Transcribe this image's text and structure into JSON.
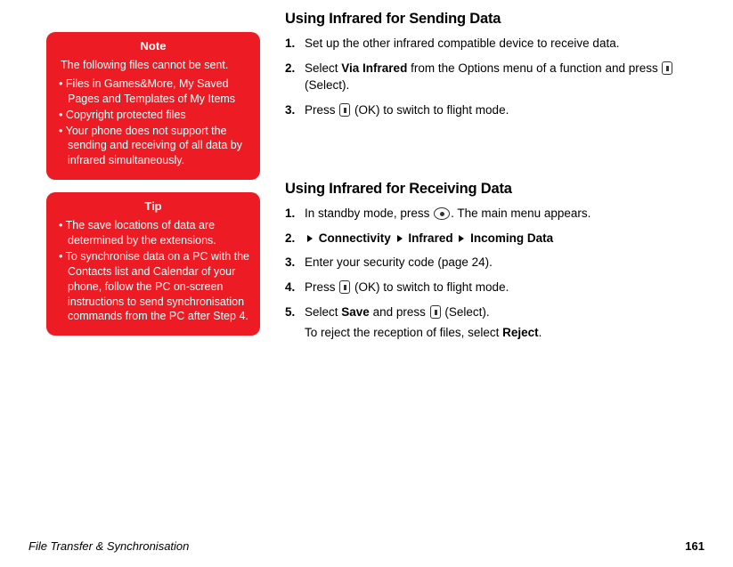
{
  "note": {
    "title": "Note",
    "intro": "The following files cannot be sent.",
    "bullets": [
      "Files in Games&More, My Saved Pages and Templates of My Items",
      "Copyright protected files",
      "Your phone does not support the sending and receiving of all data by infrared simultaneously."
    ]
  },
  "tip": {
    "title": "Tip",
    "bullets": [
      "The save locations of data are determined by the extensions.",
      "To synchronise data on a PC with the Contacts list and Calendar of your phone, follow the PC on-screen instructions to send synchronisation commands from the PC after Step 4."
    ]
  },
  "sending": {
    "title": "Using Infrared for Sending Data",
    "step1": "Set up the other infrared compatible device to receive data.",
    "step2_pre": "Select ",
    "step2_bold": "Via Infrared",
    "step2_mid": " from the Options menu of a function and press ",
    "step2_post": " (Select).",
    "step3_pre": "Press ",
    "step3_post": " (OK) to switch to flight mode."
  },
  "receiving": {
    "title": "Using Infrared for Receiving Data",
    "step1_pre": "In standby mode, press ",
    "step1_post": ". The main menu appears.",
    "step2_a": "Connectivity",
    "step2_b": "Infrared",
    "step2_c": "Incoming Data",
    "step3": "Enter your security code (page 24).",
    "step4_pre": "Press ",
    "step4_post": " (OK) to switch to flight mode.",
    "step5_pre": "Select ",
    "step5_bold1": "Save",
    "step5_mid": " and press ",
    "step5_post": " (Select).",
    "step5_sub_pre": "To reject the reception of files, select ",
    "step5_sub_bold": "Reject",
    "step5_sub_post": "."
  },
  "footer": {
    "title": "File Transfer & Synchronisation",
    "page": "161"
  }
}
